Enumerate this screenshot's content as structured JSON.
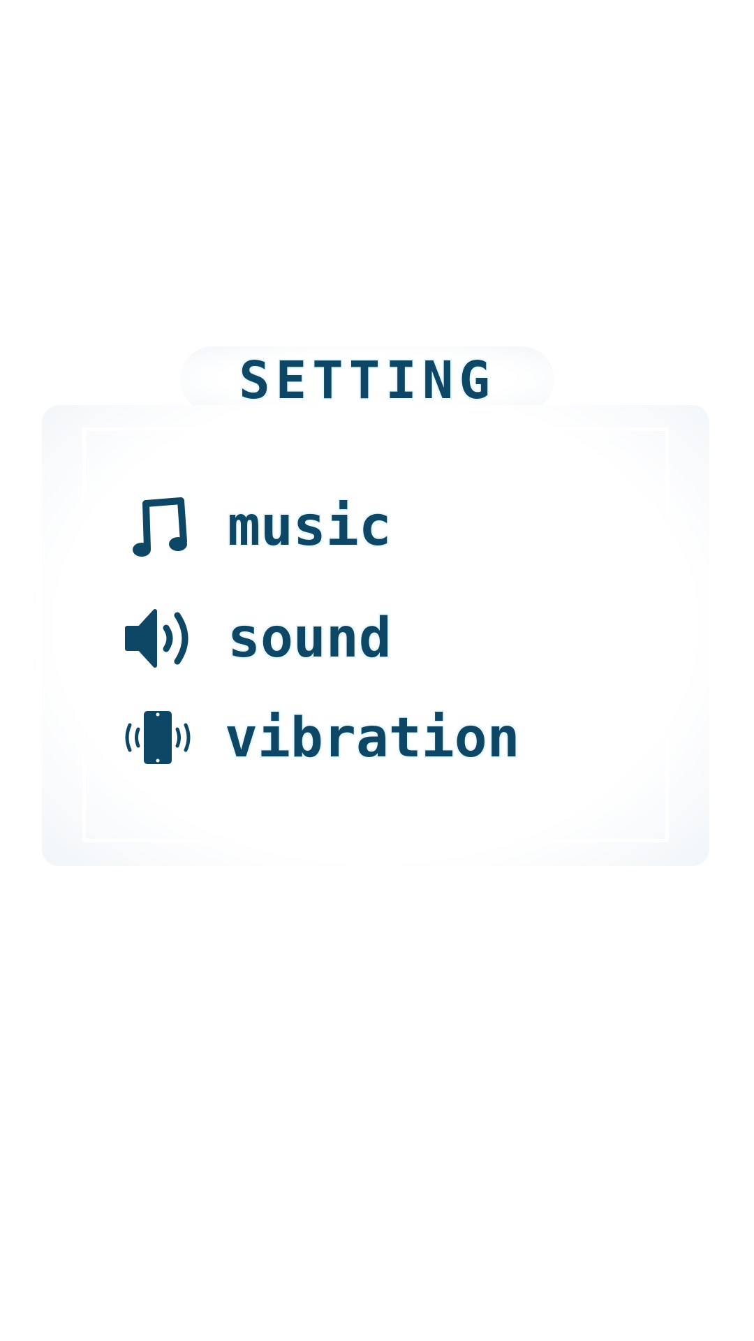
{
  "settings": {
    "title": "SETTING",
    "items": [
      {
        "label": "music",
        "icon": "music-note-icon"
      },
      {
        "label": "sound",
        "icon": "speaker-icon"
      },
      {
        "label": "vibration",
        "icon": "phone-vibration-icon"
      }
    ]
  },
  "colors": {
    "text": "#0d4765",
    "text_outline": "#e8f8ff",
    "panel_edge": "#f1f5f8",
    "background": "#ffffff"
  }
}
